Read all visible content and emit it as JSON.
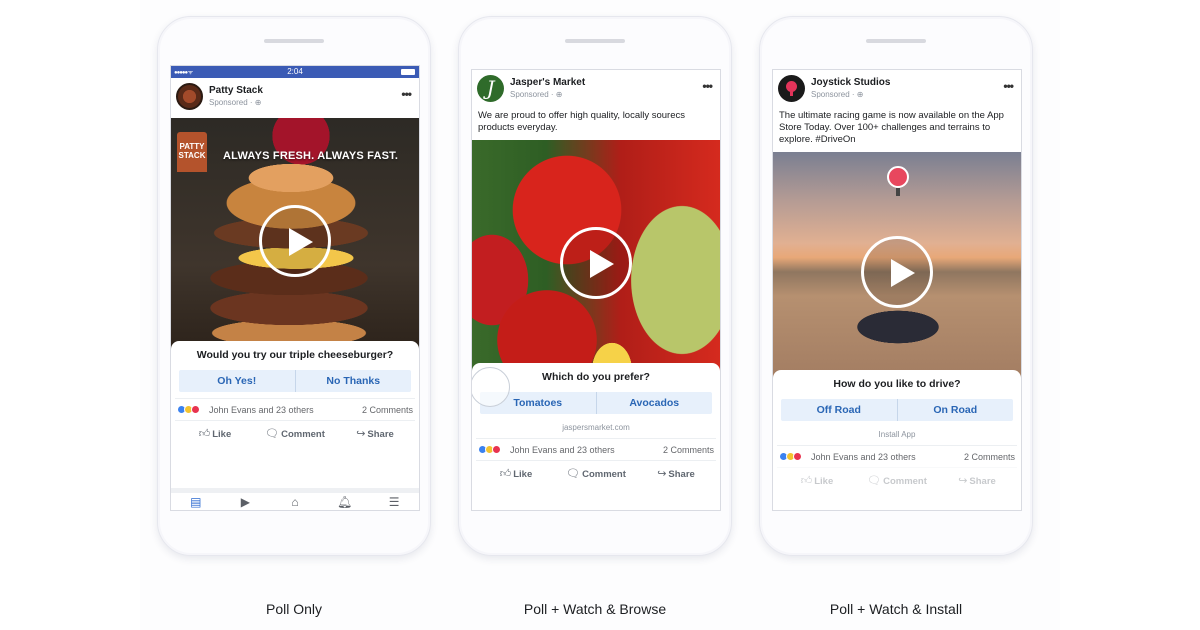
{
  "colors": {
    "statusbar": "#3b5bb5",
    "poll_option_bg": "#e7f0fb",
    "poll_option_text": "#2a66b5",
    "accent": "#2d6ad0"
  },
  "phones": [
    {
      "label": "Poll Only",
      "statusbar": {
        "time": "2:04",
        "signal": "●●●●● ᯤ"
      },
      "page_name": "Patty Stack",
      "sponsored": "Sponsored · ⊕",
      "more": "•••",
      "media": {
        "type": "video",
        "caption": "ALWAYS FRESH. ALWAYS FAST.",
        "brand_badge": "PATTY STACK"
      },
      "poll": {
        "question": "Would you try our triple cheeseburger?",
        "options": [
          "Oh Yes!",
          "No Thanks"
        ]
      },
      "reactions": {
        "names": "John Evans and 23 others",
        "comments": "2 Comments"
      },
      "actions": [
        {
          "icon": "👍︎",
          "label": "Like"
        },
        {
          "icon": "🗨︎",
          "label": "Comment"
        },
        {
          "icon": "↪",
          "label": "Share"
        }
      ],
      "tabs": [
        {
          "name": "news-feed",
          "icon": "▤"
        },
        {
          "name": "watch",
          "icon": "▶"
        },
        {
          "name": "marketplace",
          "icon": "⌂"
        },
        {
          "name": "notifications",
          "icon": "🔔︎"
        },
        {
          "name": "menu",
          "icon": "☰"
        }
      ]
    },
    {
      "label": "Poll + Watch & Browse",
      "page_name": "Jasper's Market",
      "avatar_letter": "J",
      "sponsored": "Sponsored · ⊕",
      "more": "•••",
      "post_text": "We are proud to offer high quality, locally sourecs products everyday.",
      "media": {
        "type": "video"
      },
      "poll": {
        "question": "Which do you prefer?",
        "options": [
          "Tomatoes",
          "Avocados"
        ],
        "link": "jaspersmarket.com"
      },
      "reactions": {
        "names": "John Evans and 23 others",
        "comments": "2 Comments"
      },
      "actions": [
        {
          "icon": "👍︎",
          "label": "Like"
        },
        {
          "icon": "🗨︎",
          "label": "Comment"
        },
        {
          "icon": "↪",
          "label": "Share"
        }
      ]
    },
    {
      "label": "Poll + Watch & Install",
      "page_name": "Joystick Studios",
      "sponsored": "Sponsored · ⊕",
      "more": "•••",
      "post_text": "The ultimate racing game is now available on the App Store Today. Over 100+ challenges and terrains to explore. #DriveOn",
      "media": {
        "type": "video"
      },
      "poll": {
        "question": "How do you like to drive?",
        "options": [
          "Off Road",
          "On Road"
        ],
        "link": "Install App"
      },
      "reactions": {
        "names": "John Evans and 23 others",
        "comments": "2 Comments"
      },
      "actions": [
        {
          "icon": "👍︎",
          "label": "Like"
        },
        {
          "icon": "🗨︎",
          "label": "Comment"
        },
        {
          "icon": "↪",
          "label": "Share"
        }
      ]
    }
  ]
}
